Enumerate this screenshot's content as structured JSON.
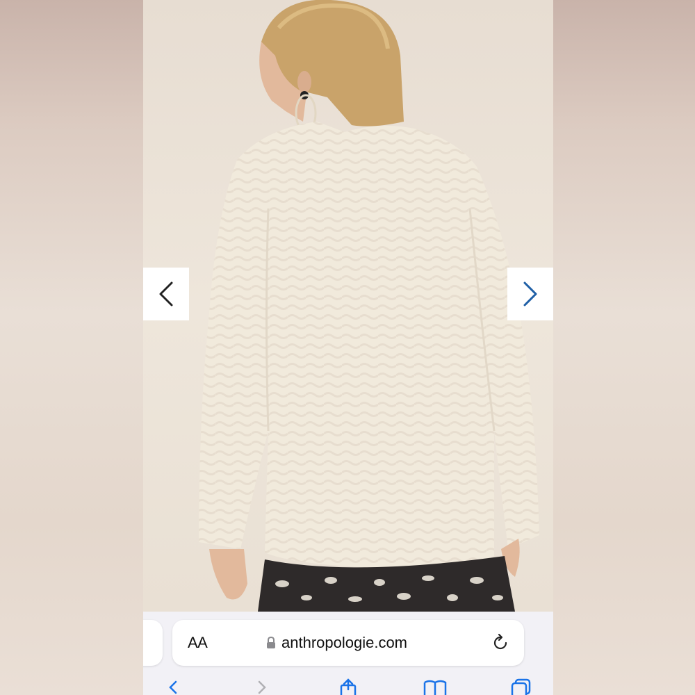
{
  "browser": {
    "url_text": "anthropologie.com",
    "text_size_label": "AA"
  },
  "gallery": {
    "prev_icon": "chevron-left-icon",
    "next_icon": "chevron-right-icon"
  },
  "toolbar": {
    "icons": [
      "back-icon",
      "forward-icon",
      "share-icon",
      "bookmarks-icon",
      "tabs-icon"
    ]
  },
  "colors": {
    "accent": "#1a73e8",
    "chrome_bg": "#f2f1f6"
  }
}
